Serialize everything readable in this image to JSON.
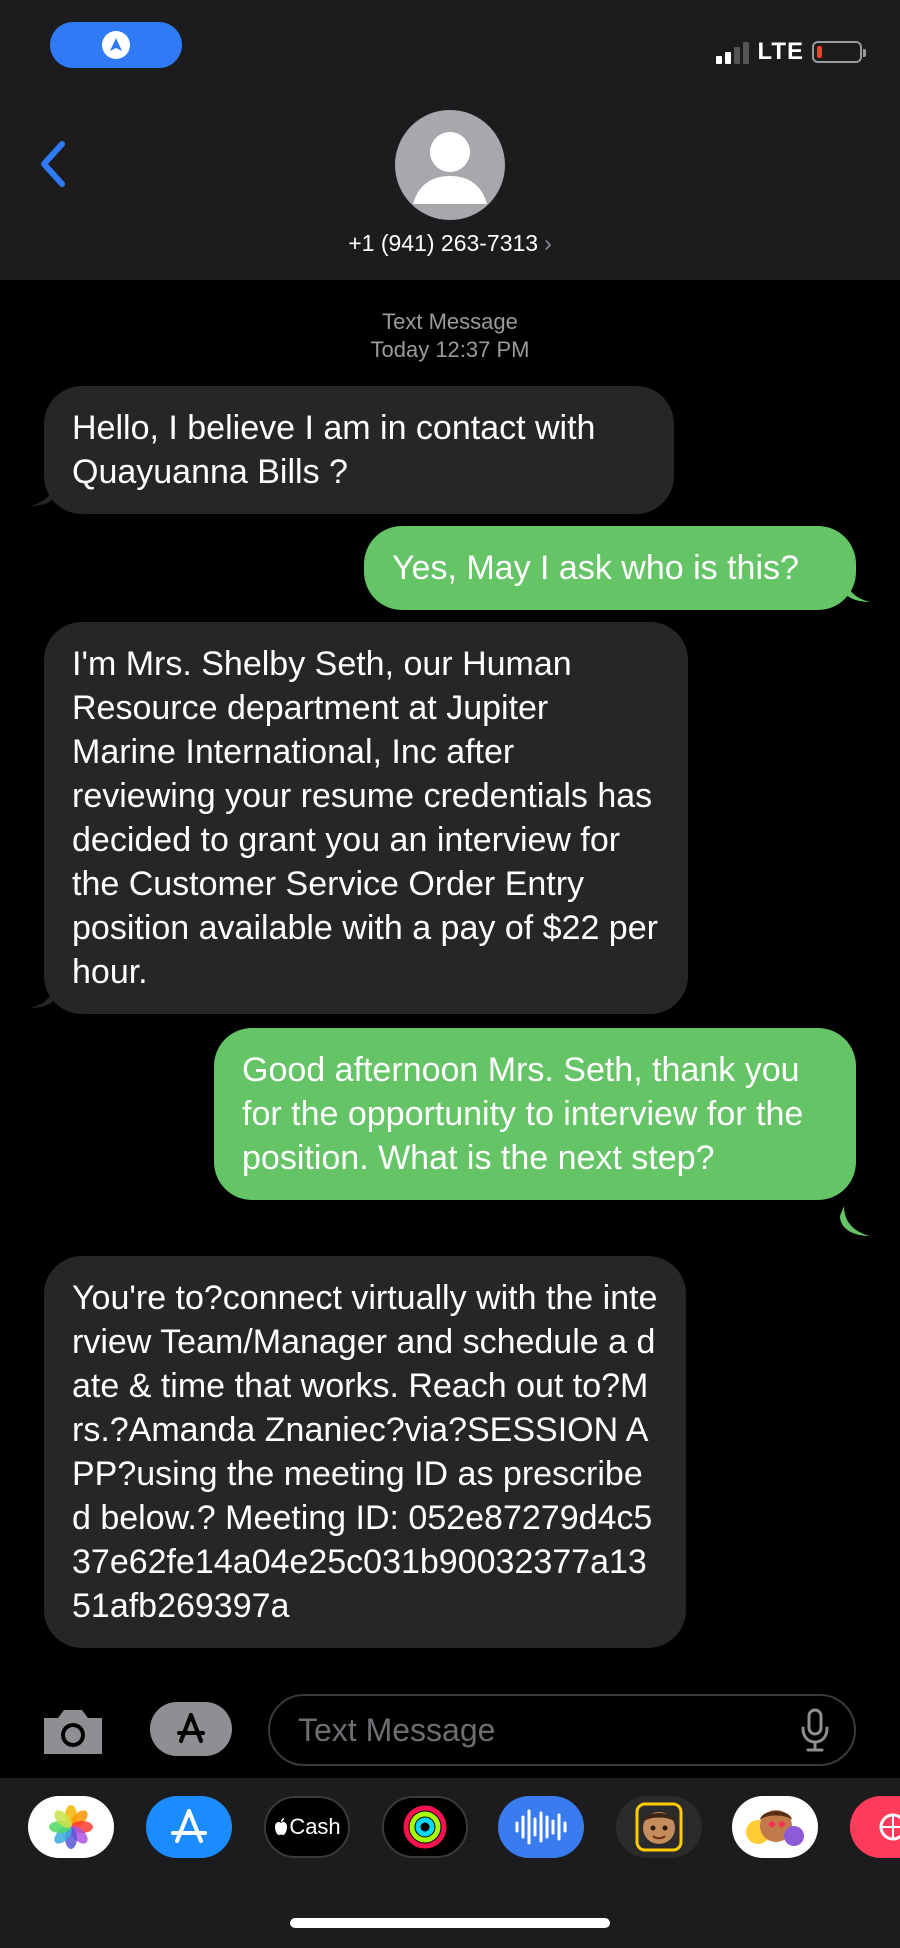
{
  "status_bar": {
    "network": "LTE",
    "battery_color": "#ff3b30"
  },
  "header": {
    "contact_name": "+1 (941) 263-7313",
    "contact_chevron": "›"
  },
  "thread": {
    "service_label": "Text Message",
    "timestamp": "Today 12:37 PM",
    "messages": [
      {
        "direction": "incoming",
        "text": "Hello, I believe I am in contact with Quayuanna Bills ?"
      },
      {
        "direction": "outgoing",
        "text": "Yes, May I ask who is this?"
      },
      {
        "direction": "incoming",
        "text": "I'm Mrs. Shelby Seth, our Human Resource department at Jupiter Marine International, Inc after reviewing your resume credentials has decided to grant you an interview for the Customer Service Order Entry position available with a pay of $22 per hour."
      },
      {
        "direction": "outgoing",
        "text": "Good afternoon Mrs. Seth, thank you for the opportunity to interview for the position. What is the next step?"
      },
      {
        "direction": "incoming",
        "text": "You're to?connect virtually with the interview Team/Manager and schedule a date & time that works. Reach out to?Mrs.?Amanda Znaniec?via?SESSION APP?using the meeting ID as prescribed below.? Meeting ID: 052e87279d4c537e62fe14a04e25c031b90032377a1351afb269397a"
      }
    ]
  },
  "composer": {
    "placeholder": "Text Message"
  },
  "app_drawer": {
    "cash_label": "Cash",
    "apps": [
      "photos-app",
      "app-store-app",
      "apple-cash-app",
      "activity-app",
      "audio-message-app",
      "memoji-app",
      "animoji-stickers-app",
      "digital-touch-app"
    ]
  },
  "colors": {
    "incoming_bubble": "#262628",
    "outgoing_bubble": "#65c466",
    "accent_blue": "#2f7bf5"
  }
}
